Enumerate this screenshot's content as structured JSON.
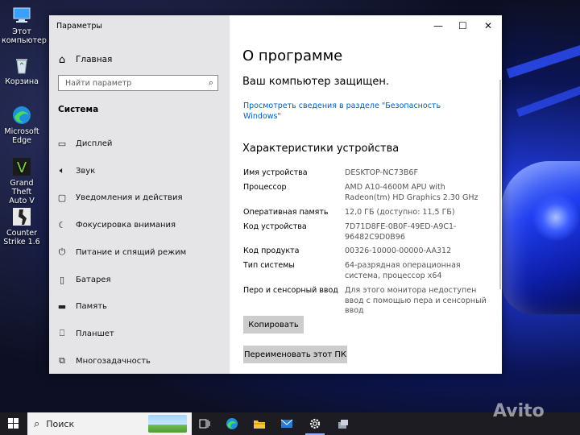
{
  "desktop": {
    "icons": [
      {
        "label_1": "Этот",
        "label_2": "компьютер",
        "icon": "this-pc-icon"
      },
      {
        "label_1": "Корзина",
        "label_2": "",
        "icon": "recycle-bin-icon"
      },
      {
        "label_1": "Microsoft",
        "label_2": "Edge",
        "icon": "edge-icon"
      },
      {
        "label_1": "Grand Theft",
        "label_2": "Auto V",
        "icon": "gta-icon"
      },
      {
        "label_1": "Counter",
        "label_2": "Strike 1.6",
        "icon": "counter-strike-icon"
      }
    ]
  },
  "window": {
    "app_title": "Параметры",
    "controls": {
      "minimize": "—",
      "maximize": "☐",
      "close": "✕"
    }
  },
  "nav": {
    "home_label": "Главная",
    "search_placeholder": "Найти параметр",
    "section_title": "Система",
    "items": [
      {
        "label": "Дисплей",
        "icon": "display-icon"
      },
      {
        "label": "Звук",
        "icon": "sound-icon"
      },
      {
        "label": "Уведомления и действия",
        "icon": "notifications-icon"
      },
      {
        "label": "Фокусировка внимания",
        "icon": "focus-assist-icon"
      },
      {
        "label": "Питание и спящий режим",
        "icon": "power-icon"
      },
      {
        "label": "Батарея",
        "icon": "battery-icon"
      },
      {
        "label": "Память",
        "icon": "storage-icon"
      },
      {
        "label": "Планшет",
        "icon": "tablet-icon"
      },
      {
        "label": "Многозадачность",
        "icon": "multitasking-icon"
      }
    ]
  },
  "main": {
    "title": "О программе",
    "protected_heading": "Ваш компьютер защищен.",
    "security_link": "Просмотреть сведения в разделе \"Безопасность Windows\"",
    "specs_heading": "Характеристики устройства",
    "specs": [
      {
        "label": "Имя устройства",
        "value": "DESKTOP-NC73B6F"
      },
      {
        "label": "Процессор",
        "value": "AMD A10-4600M APU with Radeon(tm) HD Graphics     2.30 GHz"
      },
      {
        "label": "Оперативная память",
        "value": "12,0 ГБ (доступно: 11,5 ГБ)"
      },
      {
        "label": "Код устройства",
        "value": "7D71D8FE-0B0F-49ED-A9C1-96482C9D0B96"
      },
      {
        "label": "Код продукта",
        "value": "00326-10000-00000-AA312"
      },
      {
        "label": "Тип системы",
        "value": "64-разрядная операционная система, процессор x64"
      },
      {
        "label": "Перо и сенсорный ввод",
        "value": "Для этого монитора недоступен ввод с помощью пера и сенсорный ввод"
      }
    ],
    "copy_button": "Копировать",
    "rename_button": "Переименовать этот ПК"
  },
  "taskbar": {
    "search_label": "Поиск",
    "pinned": [
      "task-view-icon",
      "edge-icon",
      "file-explorer-icon",
      "mail-icon",
      "settings-icon",
      "app-icon"
    ]
  },
  "watermark": "Avito"
}
